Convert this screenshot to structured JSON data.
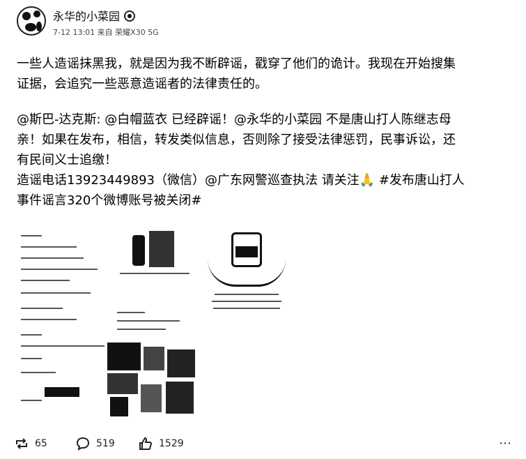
{
  "header": {
    "username": "永华的小菜园",
    "meta": "7-12 13:01 来自 荣耀X30 5G"
  },
  "post": {
    "para1_line1": "一些人造谣抹黑我，就是因为我不断辟谣，戳穿了他们的诡计。我现在开始搜集",
    "para1_line2": "证据，会追究一些恶意造谣者的法律责任的。",
    "para2_line1": "@斯巴-达克斯: @白帽蓝衣 已经辟谣！@永华的小菜园 不是唐山打人陈继志母",
    "para2_line2": "亲！如果在发布，相信，转发类似信息，否则除了接受法律惩罚，民事诉讼，还",
    "para2_line3": "有民间义士追缴！",
    "para3_line1": "造谣电话13923449893（微信）@广东网警巡查执法 请关注🙏 #发布唐山打人",
    "para3_line2": "事件谣言320个微博账号被关闭#"
  },
  "actions": {
    "repost_count": "65",
    "comment_count": "519",
    "like_count": "1529",
    "more": "⋯"
  },
  "icons": {
    "repost": "repost-icon",
    "comment": "comment-icon",
    "like": "thumbs-up-icon",
    "more": "more-icon"
  }
}
